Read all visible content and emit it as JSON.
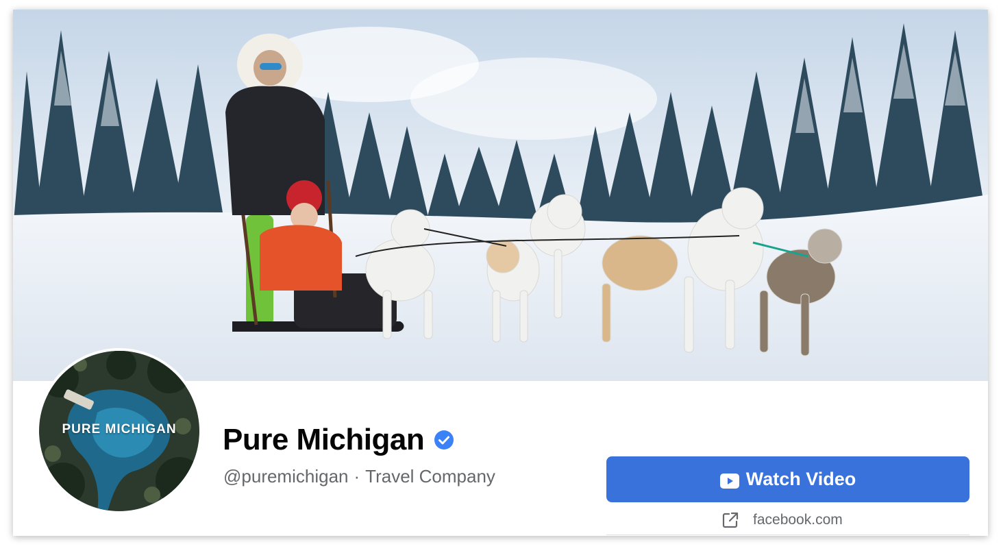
{
  "page": {
    "name": "Pure Michigan",
    "verified": true,
    "handle": "@puremichigan",
    "separator": "·",
    "category": "Travel Company"
  },
  "avatar": {
    "logo_text": "PURE MICHIGAN"
  },
  "cta": {
    "label": "Watch Video",
    "icon": "youtube-play-icon"
  },
  "link": {
    "text": "facebook.com",
    "icon": "external-link-icon"
  },
  "colors": {
    "button": "#3a72dc",
    "verified": "#3b82f6",
    "title": "#050505",
    "subtext": "#65676b"
  }
}
